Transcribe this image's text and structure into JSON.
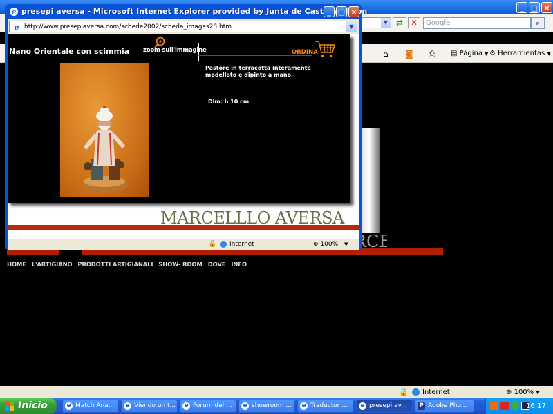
{
  "background_window": {
    "search_placeholder": "Google",
    "toolbar_page_label": "Página",
    "toolbar_tools_label": "Herramientas",
    "status_zone": "Internet",
    "status_zoom": "100%",
    "nav_items": [
      "HOME",
      "L'ARTIGIANO",
      "PRODOTTI ARTIGIANALI",
      "SHOW- ROOM",
      "DOVE",
      "INFO"
    ]
  },
  "popup": {
    "title": "presepi aversa - Microsoft Internet Explorer provided by Junta de Castilla y Leon",
    "address": "http://www.presepiaversa.com/schede2002/scheda_images28.htm",
    "product_title": "Nano Orientale con scimmia",
    "zoom_label": "zoom sull'immagine",
    "order_label": "ORDINA",
    "description": "Pastore in terracotta interamente modellato e dipinto a mano.",
    "dimensions": "Dim: h 10 cm",
    "brand": "MARCELLLO AVERSA",
    "status_zone": "Internet",
    "status_zoom": "100%"
  },
  "taskbar": {
    "start_label": "Inicio",
    "tasks": [
      "Match Ana...",
      "Viendo un t...",
      "Forum del ...",
      "showroom ...",
      "Traductor ...",
      "presepi av...",
      "Adobe Pho..."
    ],
    "active_task_index": 5,
    "clock": "16:17"
  },
  "colors": {
    "accent_red": "#b8280a",
    "order_orange": "#f08a1c",
    "titlebar_blue": "#0a52d8"
  }
}
